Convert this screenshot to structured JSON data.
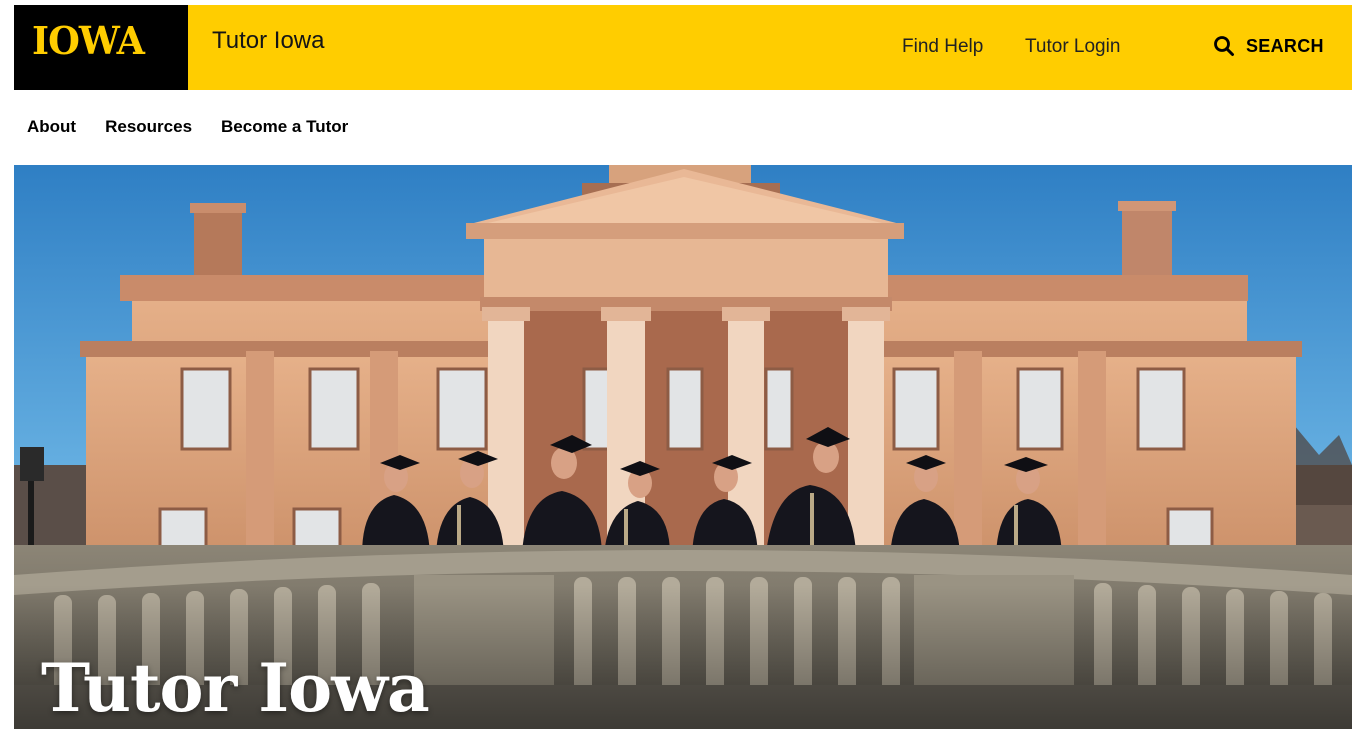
{
  "header": {
    "logo_text": "IOWA",
    "site_title": "Tutor Iowa",
    "utility_links": [
      "Find Help",
      "Tutor Login"
    ],
    "search_label": "SEARCH",
    "search_icon": "search-icon"
  },
  "nav": {
    "items": [
      "About",
      "Resources",
      "Become a Tutor"
    ]
  },
  "hero": {
    "title": "Tutor Iowa",
    "image_subject": "Graduates in caps and gowns leaning on a stone balustrade in front of a columned capitol building"
  },
  "colors": {
    "brand_gold": "#ffcd00",
    "brand_black": "#000000",
    "sky_top": "#2f7fc4",
    "sky_bottom": "#8ec9ec",
    "stone": "#d9a47c"
  }
}
